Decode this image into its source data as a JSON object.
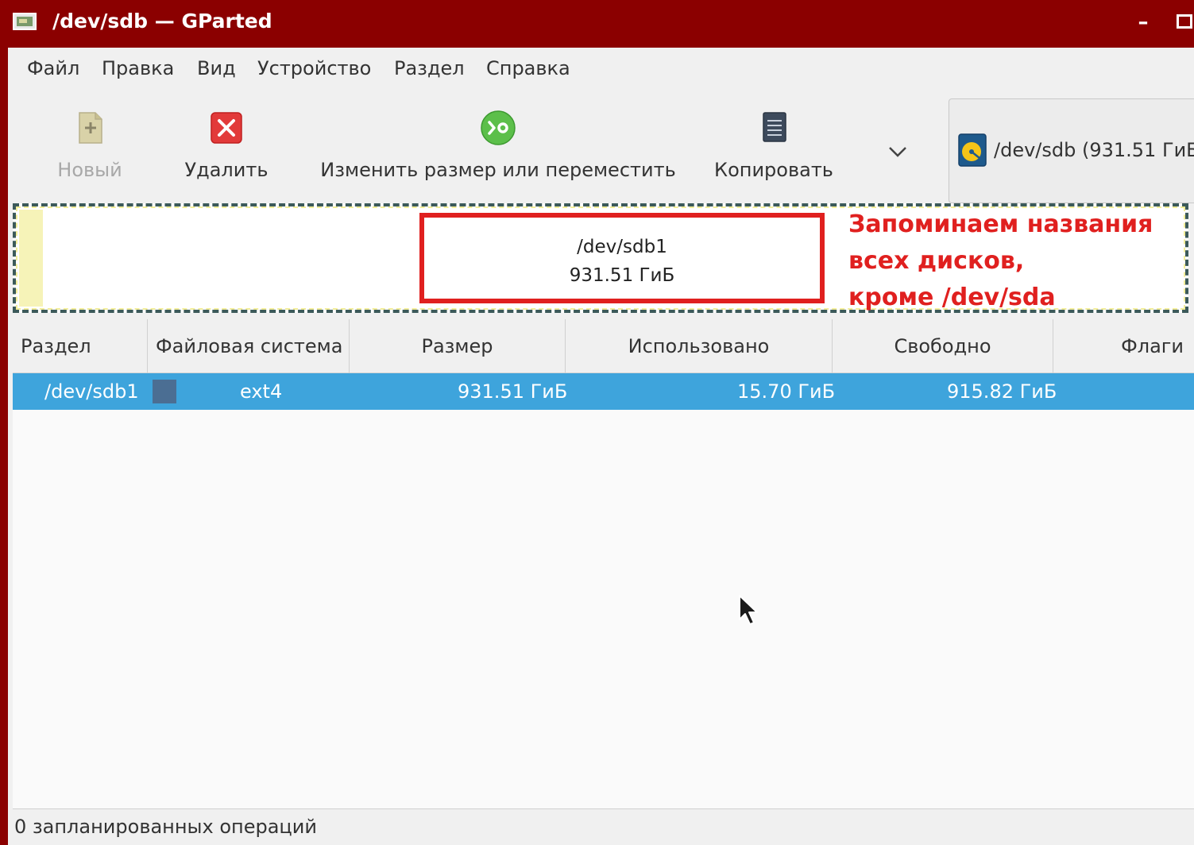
{
  "window": {
    "title": "/dev/sdb — GParted",
    "minimize_label": "–"
  },
  "menubar": {
    "items": [
      "Файл",
      "Правка",
      "Вид",
      "Устройство",
      "Раздел",
      "Справка"
    ]
  },
  "toolbar": {
    "new_label": "Новый",
    "delete_label": "Удалить",
    "resize_label": "Изменить размер или переместить",
    "copy_label": "Копировать",
    "device_label": "/dev/sdb  (931.51 ГиБ"
  },
  "partition_map": {
    "partition_name": "/dev/sdb1",
    "partition_size": "931.51 ГиБ",
    "annotation_lines": [
      "Запоминаем названия",
      "всех дисков,",
      "кроме /dev/sda"
    ]
  },
  "table": {
    "columns": [
      "Раздел",
      "Файловая система",
      "Размер",
      "Использовано",
      "Свободно",
      "Флаги"
    ],
    "rows": [
      {
        "partition": "/dev/sdb1",
        "filesystem": "ext4",
        "size": "931.51 ГиБ",
        "used": "15.70 ГиБ",
        "free": "915.82 ГиБ",
        "flags": ""
      }
    ]
  },
  "statusbar": {
    "text": "0 запланированных операций"
  },
  "colors": {
    "titlebar": "#8b0000",
    "selection": "#3ea4dc",
    "annotation": "#e0201f",
    "fs_ext4": "#4b6e93"
  }
}
